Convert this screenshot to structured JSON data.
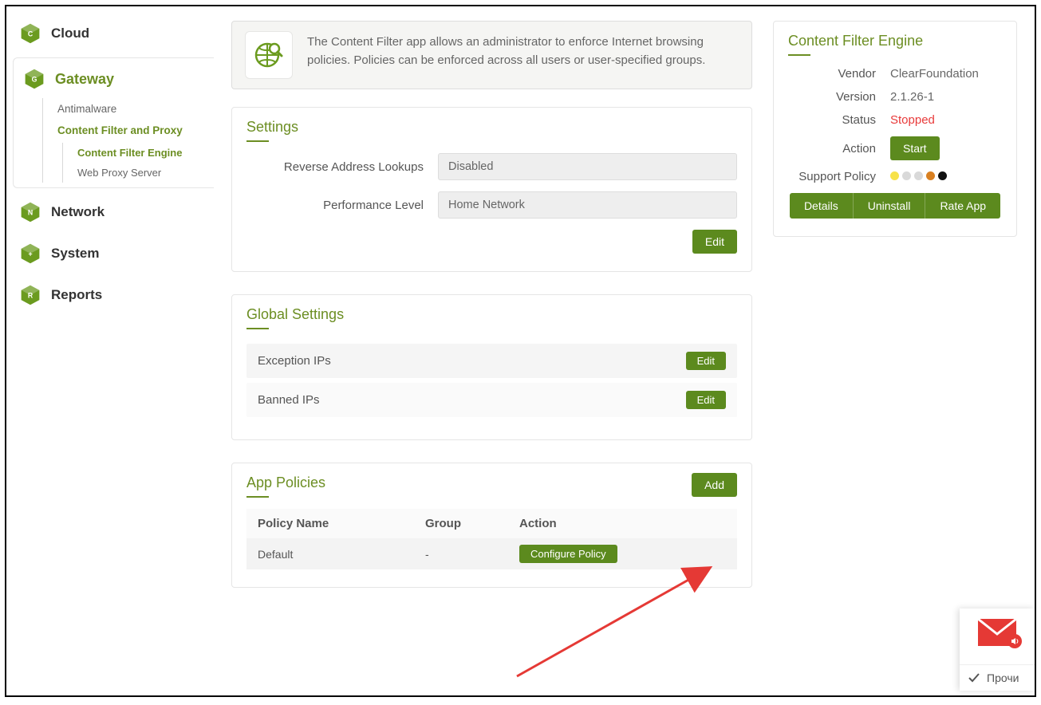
{
  "nav": {
    "cloud": "Cloud",
    "gateway": "Gateway",
    "network": "Network",
    "system": "System",
    "reports": "Reports",
    "gateway_sub": {
      "antimalware": "Antimalware",
      "cfp": "Content Filter and Proxy",
      "cfe": "Content Filter Engine",
      "wps": "Web Proxy Server"
    }
  },
  "description": "The Content Filter app allows an administrator to enforce Internet browsing policies. Policies can be enforced across all users or user-specified groups.",
  "settings": {
    "title": "Settings",
    "reverse_label": "Reverse Address Lookups",
    "reverse_value": "Disabled",
    "perf_label": "Performance Level",
    "perf_value": "Home Network",
    "edit": "Edit"
  },
  "global": {
    "title": "Global Settings",
    "exception": "Exception IPs",
    "banned": "Banned IPs",
    "edit": "Edit"
  },
  "policies": {
    "title": "App Policies",
    "add": "Add",
    "col_name": "Policy Name",
    "col_group": "Group",
    "col_action": "Action",
    "row_name": "Default",
    "row_group": "-",
    "configure": "Configure Policy"
  },
  "engine": {
    "title": "Content Filter Engine",
    "vendor_label": "Vendor",
    "vendor": "ClearFoundation",
    "version_label": "Version",
    "version": "2.1.26-1",
    "status_label": "Status",
    "status": "Stopped",
    "action_label": "Action",
    "start": "Start",
    "support_label": "Support Policy",
    "details": "Details",
    "uninstall": "Uninstall",
    "rate": "Rate App"
  },
  "colors": {
    "dot1": "#f7e24a",
    "dot2": "#d9d9d9",
    "dot3": "#d9d9d9",
    "dot4": "#d98021",
    "dot5": "#111111"
  },
  "widget": {
    "label": "Прочи"
  }
}
